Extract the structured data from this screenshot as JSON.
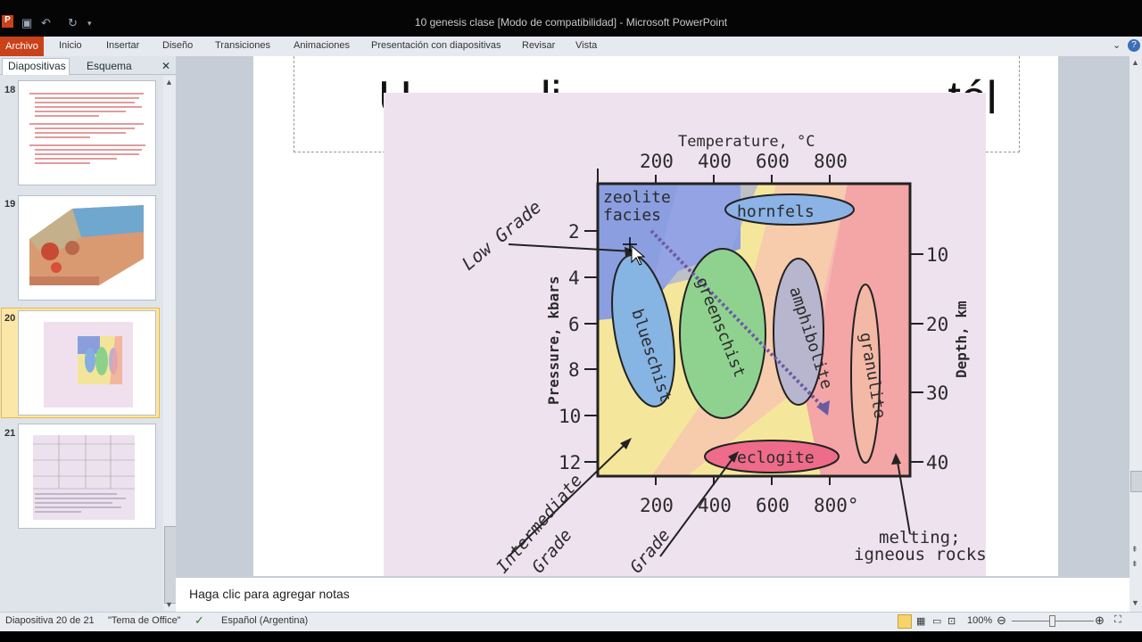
{
  "window": {
    "title": "10 genesis clase [Modo de compatibilidad] - Microsoft PowerPoint"
  },
  "ribbon": {
    "tabs": [
      "Archivo",
      "Inicio",
      "Insertar",
      "Diseño",
      "Transiciones",
      "Animaciones",
      "Presentación con diapositivas",
      "Revisar",
      "Vista"
    ]
  },
  "panel": {
    "tab_slides": "Diapositivas",
    "tab_outline": "Esquema",
    "close": "✕",
    "thumbnails": [
      {
        "num": "18"
      },
      {
        "num": "19"
      },
      {
        "num": "20"
      },
      {
        "num": "21"
      }
    ]
  },
  "slide": {
    "title_partial": "U          li                              tél"
  },
  "diagram": {
    "top_axis_title": "Temperature, °C",
    "top_ticks": [
      "200",
      "400",
      "600",
      "800"
    ],
    "bottom_ticks": [
      "200",
      "400",
      "600",
      "800°"
    ],
    "left_axis_title": "Pressure, kbars",
    "left_ticks": [
      "2",
      "4",
      "6",
      "8",
      "10",
      "12"
    ],
    "right_axis_title": "Depth, km",
    "right_ticks": [
      "10",
      "20",
      "30",
      "40"
    ],
    "facies": [
      "zeolite",
      "facies",
      "hornfels",
      "blueschist",
      "greenschist",
      "amphibolite",
      "granulite",
      "eclogite"
    ],
    "labels": {
      "low": "Low Grade",
      "intermediate1": "Intermediate",
      "intermediate2": "Grade",
      "high": "Grade",
      "melting1": "melting;",
      "melting2": "igneous rocks"
    }
  },
  "notes": {
    "placeholder": "Haga clic para agregar notas"
  },
  "status": {
    "slide_count": "Diapositiva 20 de 21",
    "theme": "\"Tema de Office\"",
    "language": "Español (Argentina)",
    "zoom": "100%"
  },
  "colors": {
    "archivo_tab": "#c9421a",
    "selected_thumb": "#fbe7a8"
  }
}
